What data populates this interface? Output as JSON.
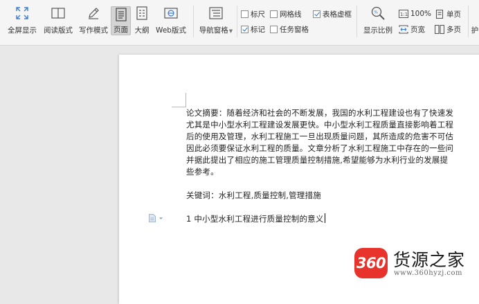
{
  "toolbar": {
    "fullscreen": "全屏显示",
    "reading_mode": "阅读版式",
    "writing_mode": "写作模式",
    "page": "页面",
    "outline": "大纲",
    "web": "Web版式",
    "nav_pane": "导航窗格",
    "ruler": "标尺",
    "gridlines": "网格线",
    "table_gridlines": "表格虚框",
    "marks": "标记",
    "task_pane": "任务窗格",
    "zoom_ratio": "显示比例",
    "zoom_value": "100%",
    "page_width": "页宽",
    "single_page": "单页",
    "multi_page": "多页",
    "more": "护"
  },
  "checkbox_state": {
    "ruler": false,
    "gridlines": false,
    "table_gridlines": true,
    "marks": true,
    "task_pane": false
  },
  "document": {
    "lines": [
      "论文摘要：随着经济和社会的不断发展，我国的水利工程建设也有了快速发",
      "尤其是中小型水利工程建设发展更快。中小型水利工程质量直接影响着工程",
      "后的使用及管理，水利工程施工一旦出现质量问题，其所造成的危害不可估",
      "因此必须要保证水利工程的质量。文章分析了水利工程施工中存在的一些问",
      "并据此提出了相应的施工管理质量控制措施,希望能够为水利行业的发展提",
      "些参考。"
    ],
    "keywords": "关键词：水利工程,质量控制,管理措施",
    "heading": "1 中小型水利工程进行质量控制的意义"
  },
  "watermark": {
    "badge": "360",
    "title": "货源之家",
    "url": "www.360hyzj.com"
  },
  "colors": {
    "accent": "#2d6fc4",
    "badge_red": "#e8332d"
  }
}
